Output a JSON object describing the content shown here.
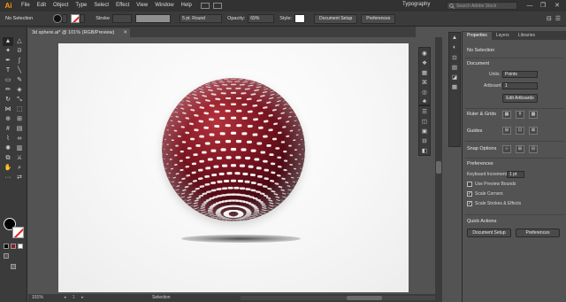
{
  "app": {
    "logo": "Ai",
    "workspace": "Typography"
  },
  "menu": [
    "File",
    "Edit",
    "Object",
    "Type",
    "Select",
    "Effect",
    "View",
    "Window",
    "Help"
  ],
  "search": {
    "placeholder": "Search Adobe Stock"
  },
  "window_controls": {
    "minimize": "—",
    "restore": "❐",
    "close": "✕"
  },
  "control_bar": {
    "selection_label": "No Selection",
    "stroke_label": "Stroke",
    "brush_label": "5 pt. Round",
    "opacity_label": "Opacity:",
    "opacity_value": "69%",
    "style_label": "Style:",
    "document_setup": "Document Setup",
    "preferences": "Preferences"
  },
  "document": {
    "tab_title": "3d sphere.ai* @ 101% (RGB/Preview)",
    "close": "✕"
  },
  "status_bar": {
    "zoom": "101%",
    "nav": "◂ 1 ▸",
    "tool": "Selection"
  },
  "tools": [
    {
      "name": "selection-tool",
      "glyph": "▲",
      "active": true
    },
    {
      "name": "direct-selection-tool",
      "glyph": "△"
    },
    {
      "name": "magic-wand-tool",
      "glyph": "✦"
    },
    {
      "name": "lasso-tool",
      "glyph": "ᘐ"
    },
    {
      "name": "pen-tool",
      "glyph": "✒"
    },
    {
      "name": "curvature-tool",
      "glyph": "∫"
    },
    {
      "name": "type-tool",
      "glyph": "T"
    },
    {
      "name": "line-tool",
      "glyph": "╲"
    },
    {
      "name": "rectangle-tool",
      "glyph": "▭"
    },
    {
      "name": "paintbrush-tool",
      "glyph": "✎"
    },
    {
      "name": "pencil-tool",
      "glyph": "✏"
    },
    {
      "name": "eraser-tool",
      "glyph": "◈"
    },
    {
      "name": "rotate-tool",
      "glyph": "↻"
    },
    {
      "name": "scale-tool",
      "glyph": "⤡"
    },
    {
      "name": "width-tool",
      "glyph": "⋈"
    },
    {
      "name": "free-transform-tool",
      "glyph": "⬚"
    },
    {
      "name": "shape-builder-tool",
      "glyph": "⊕"
    },
    {
      "name": "perspective-grid-tool",
      "glyph": "⊞"
    },
    {
      "name": "mesh-tool",
      "glyph": "#"
    },
    {
      "name": "gradient-tool",
      "glyph": "▤"
    },
    {
      "name": "eyedropper-tool",
      "glyph": "⌇"
    },
    {
      "name": "blend-tool",
      "glyph": "∞"
    },
    {
      "name": "symbol-sprayer-tool",
      "glyph": "✺"
    },
    {
      "name": "column-graph-tool",
      "glyph": "▥"
    },
    {
      "name": "artboard-tool",
      "glyph": "⧉"
    },
    {
      "name": "slice-tool",
      "glyph": "⚔"
    },
    {
      "name": "hand-tool",
      "glyph": "✋"
    },
    {
      "name": "zoom-tool",
      "glyph": "⌕"
    },
    {
      "name": "edit-toolbar-button",
      "glyph": "···"
    },
    {
      "name": "swap-colors-icon",
      "glyph": "⇄"
    }
  ],
  "panel_strip_a": [
    "◉",
    "❖",
    "▦",
    "⌘",
    "◎",
    "♣",
    "◼",
    "⚑"
  ],
  "panel_strip_b": [
    "☰",
    "◫",
    "▣",
    "⊟",
    "◧"
  ],
  "panel_strip_c": [
    "▲",
    "◐",
    "⊡",
    "▧",
    "◪",
    "▩"
  ],
  "properties": {
    "tabs": [
      "Properties",
      "Layers",
      "Libraries"
    ],
    "no_selection": "No Selection",
    "document_title": "Document",
    "units_label": "Units:",
    "units_value": "Points",
    "artboard_label": "Artboard:",
    "artboard_value": "1",
    "edit_artboards": "Edit Artboards",
    "rulers_title": "Ruler & Grids",
    "guides_title": "Guides",
    "snap_title": "Snap Options",
    "preferences_title": "Preferences",
    "keyboard_increment_label": "Keyboard Increment:",
    "keyboard_increment_value": "1 pt",
    "use_preview_bounds": "Use Preview Bounds",
    "scale_corners": "Scale Corners",
    "scale_strokes": "Scale Strokes & Effects",
    "quick_actions_title": "Quick Actions",
    "document_setup": "Document Setup",
    "preferences_btn": "Preferences"
  },
  "colors": {
    "accent": "#ff9a00",
    "sphere_dark": "#4a0a12",
    "sphere_mid": "#8b1a24",
    "tile": "#ffffff"
  }
}
